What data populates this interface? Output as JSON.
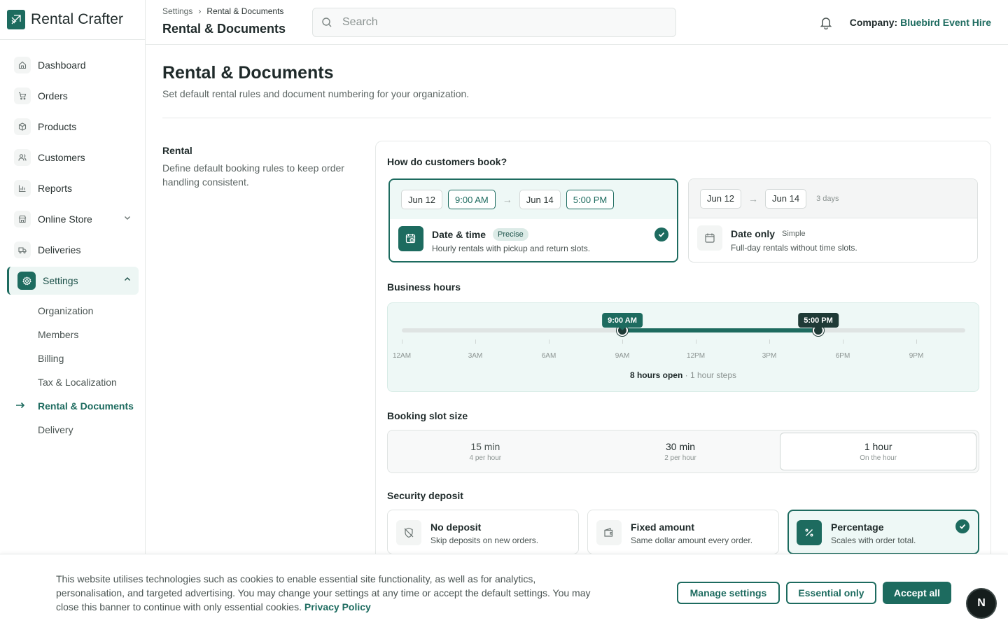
{
  "app": {
    "name": "Rental Crafter"
  },
  "sidebar": {
    "items": [
      {
        "label": "Dashboard",
        "icon": "home-icon"
      },
      {
        "label": "Orders",
        "icon": "cart-icon"
      },
      {
        "label": "Products",
        "icon": "box-icon"
      },
      {
        "label": "Customers",
        "icon": "users-icon"
      },
      {
        "label": "Reports",
        "icon": "bar-chart-icon"
      },
      {
        "label": "Online Store",
        "icon": "store-icon"
      },
      {
        "label": "Deliveries",
        "icon": "truck-icon"
      },
      {
        "label": "Settings",
        "icon": "gear-icon"
      }
    ],
    "settings_sub": [
      "Organization",
      "Members",
      "Billing",
      "Tax & Localization",
      "Rental & Documents",
      "Delivery"
    ],
    "current_sub": "Rental & Documents"
  },
  "header": {
    "breadcrumb": [
      "Settings",
      "Rental & Documents"
    ],
    "breadcrumb_sep": "›",
    "title": "Rental & Documents",
    "search_placeholder": "Search",
    "company_label": "Company:",
    "company_name": "Bluebird Event Hire"
  },
  "page": {
    "title": "Rental & Documents",
    "subtitle": "Set default rental rules and document numbering for your organization."
  },
  "rental_section": {
    "title": "Rental",
    "description": "Define default booking rules to keep order handling consistent."
  },
  "booking": {
    "question": "How do customers book?",
    "arrow": "→",
    "options": [
      {
        "name": "Date & time",
        "badge": "Precise",
        "description": "Hourly rentals with pickup and return slots.",
        "start_date": "Jun 12",
        "start_time": "9:00 AM",
        "end_date": "Jun 14",
        "end_time": "5:00 PM",
        "selected": true
      },
      {
        "name": "Date only",
        "badge": "Simple",
        "description": "Full-day rentals without time slots.",
        "start_date": "Jun 12",
        "end_date": "Jun 14",
        "duration": "3 days",
        "selected": false
      }
    ]
  },
  "business_hours": {
    "label": "Business hours",
    "open": "9:00 AM",
    "close": "5:00 PM",
    "open_hour": 9,
    "close_hour": 17,
    "ticks": [
      "12AM",
      "3AM",
      "6AM",
      "9AM",
      "12PM",
      "3PM",
      "6PM",
      "9PM"
    ],
    "summary": "8 hours open",
    "step_note": "· 1 hour steps"
  },
  "slot_size": {
    "label": "Booking slot size",
    "options": [
      {
        "label": "15 min",
        "sub": "4 per hour"
      },
      {
        "label": "30 min",
        "sub": "2 per hour"
      },
      {
        "label": "1 hour",
        "sub": "On the hour"
      }
    ],
    "selected": "1 hour"
  },
  "deposit": {
    "label": "Security deposit",
    "options": [
      {
        "name": "No deposit",
        "description": "Skip deposits on new orders.",
        "icon": "shield-off-icon"
      },
      {
        "name": "Fixed amount",
        "description": "Same dollar amount every order.",
        "icon": "wallet-icon"
      },
      {
        "name": "Percentage",
        "description": "Scales with order total.",
        "icon": "percent-icon"
      }
    ],
    "selected": "Percentage"
  },
  "cookie": {
    "text": "This website utilises technologies such as cookies to enable essential site functionality, as well as for analytics, personalisation, and targeted advertising. You may change your settings at any time or accept the default settings. You may close this banner to continue with only essential cookies.",
    "link": "Privacy Policy",
    "manage": "Manage settings",
    "essential": "Essential only",
    "accept": "Accept all"
  },
  "badge": {
    "letter": "N"
  },
  "colors": {
    "accent": "#1d6b5f",
    "accent_light": "#eef8f6"
  }
}
